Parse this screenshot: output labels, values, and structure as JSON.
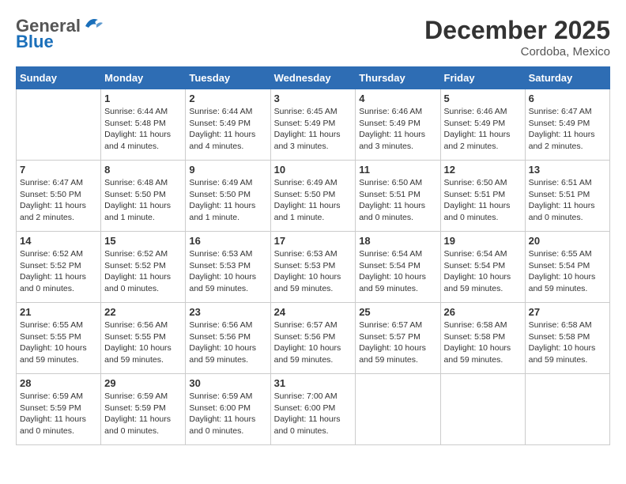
{
  "header": {
    "logo_general": "General",
    "logo_blue": "Blue",
    "month_title": "December 2025",
    "location": "Cordoba, Mexico"
  },
  "weekdays": [
    "Sunday",
    "Monday",
    "Tuesday",
    "Wednesday",
    "Thursday",
    "Friday",
    "Saturday"
  ],
  "weeks": [
    [
      {
        "day": "",
        "info": ""
      },
      {
        "day": "1",
        "info": "Sunrise: 6:44 AM\nSunset: 5:48 PM\nDaylight: 11 hours\nand 4 minutes."
      },
      {
        "day": "2",
        "info": "Sunrise: 6:44 AM\nSunset: 5:49 PM\nDaylight: 11 hours\nand 4 minutes."
      },
      {
        "day": "3",
        "info": "Sunrise: 6:45 AM\nSunset: 5:49 PM\nDaylight: 11 hours\nand 3 minutes."
      },
      {
        "day": "4",
        "info": "Sunrise: 6:46 AM\nSunset: 5:49 PM\nDaylight: 11 hours\nand 3 minutes."
      },
      {
        "day": "5",
        "info": "Sunrise: 6:46 AM\nSunset: 5:49 PM\nDaylight: 11 hours\nand 2 minutes."
      },
      {
        "day": "6",
        "info": "Sunrise: 6:47 AM\nSunset: 5:49 PM\nDaylight: 11 hours\nand 2 minutes."
      }
    ],
    [
      {
        "day": "7",
        "info": "Sunrise: 6:47 AM\nSunset: 5:50 PM\nDaylight: 11 hours\nand 2 minutes."
      },
      {
        "day": "8",
        "info": "Sunrise: 6:48 AM\nSunset: 5:50 PM\nDaylight: 11 hours\nand 1 minute."
      },
      {
        "day": "9",
        "info": "Sunrise: 6:49 AM\nSunset: 5:50 PM\nDaylight: 11 hours\nand 1 minute."
      },
      {
        "day": "10",
        "info": "Sunrise: 6:49 AM\nSunset: 5:50 PM\nDaylight: 11 hours\nand 1 minute."
      },
      {
        "day": "11",
        "info": "Sunrise: 6:50 AM\nSunset: 5:51 PM\nDaylight: 11 hours\nand 0 minutes."
      },
      {
        "day": "12",
        "info": "Sunrise: 6:50 AM\nSunset: 5:51 PM\nDaylight: 11 hours\nand 0 minutes."
      },
      {
        "day": "13",
        "info": "Sunrise: 6:51 AM\nSunset: 5:51 PM\nDaylight: 11 hours\nand 0 minutes."
      }
    ],
    [
      {
        "day": "14",
        "info": "Sunrise: 6:52 AM\nSunset: 5:52 PM\nDaylight: 11 hours\nand 0 minutes."
      },
      {
        "day": "15",
        "info": "Sunrise: 6:52 AM\nSunset: 5:52 PM\nDaylight: 11 hours\nand 0 minutes."
      },
      {
        "day": "16",
        "info": "Sunrise: 6:53 AM\nSunset: 5:53 PM\nDaylight: 10 hours\nand 59 minutes."
      },
      {
        "day": "17",
        "info": "Sunrise: 6:53 AM\nSunset: 5:53 PM\nDaylight: 10 hours\nand 59 minutes."
      },
      {
        "day": "18",
        "info": "Sunrise: 6:54 AM\nSunset: 5:54 PM\nDaylight: 10 hours\nand 59 minutes."
      },
      {
        "day": "19",
        "info": "Sunrise: 6:54 AM\nSunset: 5:54 PM\nDaylight: 10 hours\nand 59 minutes."
      },
      {
        "day": "20",
        "info": "Sunrise: 6:55 AM\nSunset: 5:54 PM\nDaylight: 10 hours\nand 59 minutes."
      }
    ],
    [
      {
        "day": "21",
        "info": "Sunrise: 6:55 AM\nSunset: 5:55 PM\nDaylight: 10 hours\nand 59 minutes."
      },
      {
        "day": "22",
        "info": "Sunrise: 6:56 AM\nSunset: 5:55 PM\nDaylight: 10 hours\nand 59 minutes."
      },
      {
        "day": "23",
        "info": "Sunrise: 6:56 AM\nSunset: 5:56 PM\nDaylight: 10 hours\nand 59 minutes."
      },
      {
        "day": "24",
        "info": "Sunrise: 6:57 AM\nSunset: 5:56 PM\nDaylight: 10 hours\nand 59 minutes."
      },
      {
        "day": "25",
        "info": "Sunrise: 6:57 AM\nSunset: 5:57 PM\nDaylight: 10 hours\nand 59 minutes."
      },
      {
        "day": "26",
        "info": "Sunrise: 6:58 AM\nSunset: 5:58 PM\nDaylight: 10 hours\nand 59 minutes."
      },
      {
        "day": "27",
        "info": "Sunrise: 6:58 AM\nSunset: 5:58 PM\nDaylight: 10 hours\nand 59 minutes."
      }
    ],
    [
      {
        "day": "28",
        "info": "Sunrise: 6:59 AM\nSunset: 5:59 PM\nDaylight: 11 hours\nand 0 minutes."
      },
      {
        "day": "29",
        "info": "Sunrise: 6:59 AM\nSunset: 5:59 PM\nDaylight: 11 hours\nand 0 minutes."
      },
      {
        "day": "30",
        "info": "Sunrise: 6:59 AM\nSunset: 6:00 PM\nDaylight: 11 hours\nand 0 minutes."
      },
      {
        "day": "31",
        "info": "Sunrise: 7:00 AM\nSunset: 6:00 PM\nDaylight: 11 hours\nand 0 minutes."
      },
      {
        "day": "",
        "info": ""
      },
      {
        "day": "",
        "info": ""
      },
      {
        "day": "",
        "info": ""
      }
    ]
  ]
}
